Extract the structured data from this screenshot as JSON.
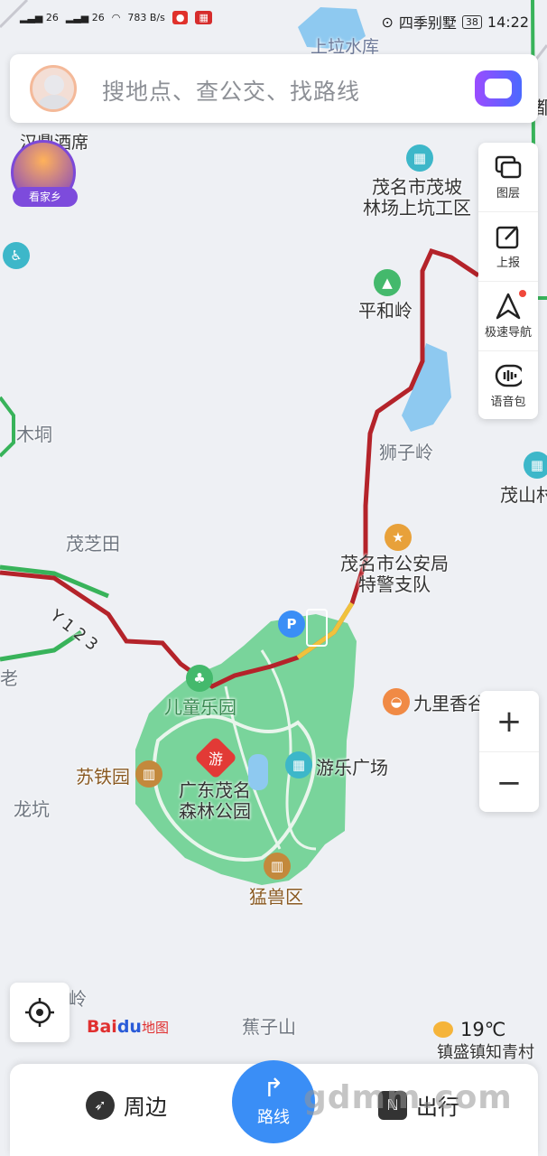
{
  "status_bar": {
    "signal1": "26",
    "signal2": "26",
    "net_speed": "783 B/s",
    "location_text": "四季别墅",
    "battery": "38",
    "time": "14:22"
  },
  "search": {
    "placeholder": "搜地点、查公交、找路线"
  },
  "hometown_badge": {
    "label": "看家乡"
  },
  "side_panel": {
    "items": [
      {
        "label": "图层",
        "icon": "layers-icon"
      },
      {
        "label": "上报",
        "icon": "report-icon"
      },
      {
        "label": "极速导航",
        "icon": "navigation-icon"
      },
      {
        "label": "语音包",
        "icon": "voice-pack-icon"
      }
    ]
  },
  "map": {
    "labels": {
      "reservoir": "上垃水库",
      "hotel": "汉鼎酒席",
      "forest_farm": "茂名市茂坡\n林场上坑工区",
      "pinghe": "平和岭",
      "mudong": "木垌",
      "shiziling": "狮子岭",
      "maoshan": "茂山村",
      "maozhitian": "茂芝田",
      "police": "茂名市公安局\n特警支队",
      "road": "Y123",
      "kids_park": "儿童乐园",
      "jiuli": "九里香谷",
      "sutie": "苏铁园",
      "park": "广东茂名\n森林公园",
      "plaza": "游乐广场",
      "longkeng": "龙坑",
      "beast": "猛兽区",
      "jiaozishan": "蕉子山",
      "jiao_town": "镇盛镇知青村",
      "lao": "老",
      "ling": "岭",
      "right_edge": "都"
    },
    "scenic_marker": "游"
  },
  "zoom": {
    "in": "+",
    "out": "−"
  },
  "logo": {
    "part1": "Bai",
    "part2": "du",
    "part3": "地图"
  },
  "weather": {
    "temp": "19℃"
  },
  "bottom_bar": {
    "nearby": "周边",
    "route": "路线",
    "travel": "出行"
  },
  "watermark": "gdmm.com",
  "colors": {
    "route_red": "#b4232a",
    "route_green": "#38b35a",
    "park_green": "#79d49b",
    "water_blue": "#8ec9f0",
    "accent_blue": "#3a8ef6"
  }
}
